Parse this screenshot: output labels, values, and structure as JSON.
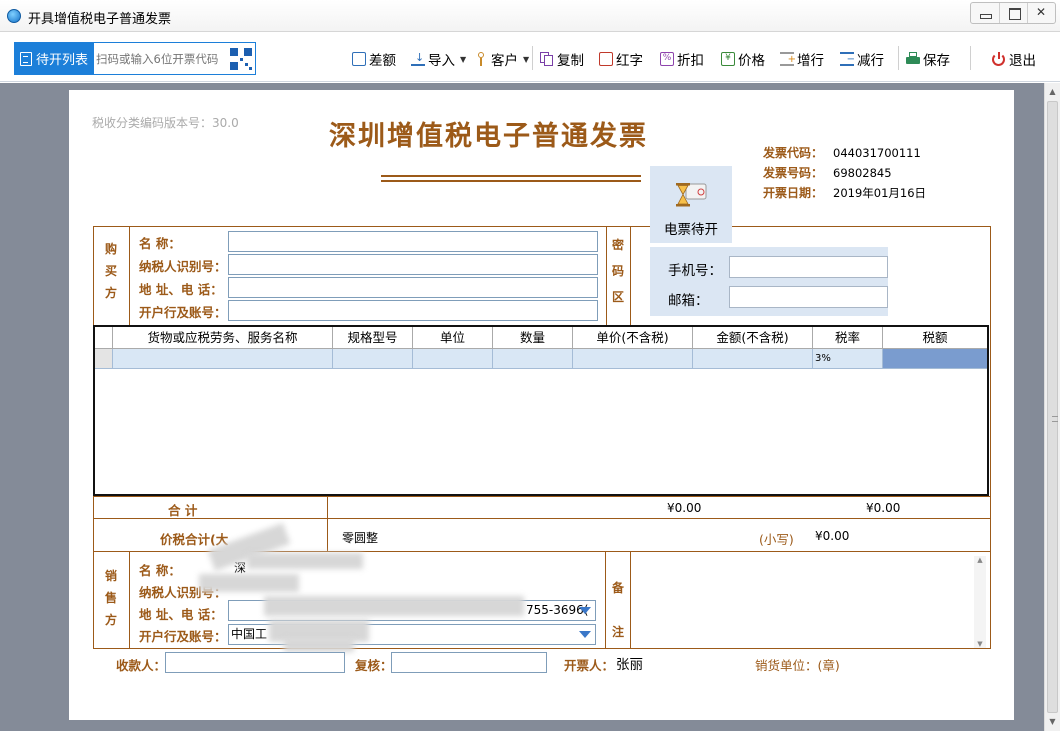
{
  "window": {
    "title": "开具增值税电子普通发票"
  },
  "toolbar": {
    "pending_list": "待开列表",
    "scan_placeholder": "扫码或输入6位开票代码",
    "items": {
      "diff": "差额",
      "import": "导入",
      "customer": "客户",
      "copy": "复制",
      "red": "红字",
      "discount": "折扣",
      "price": "价格",
      "add_row": "增行",
      "del_row": "减行",
      "save": "保存",
      "exit": "退出"
    }
  },
  "invoice": {
    "category_version": "税收分类编码版本号：30.0",
    "title": "深圳增值税电子普通发票",
    "code_label": "发票代码：",
    "code": "044031700111",
    "number_label": "发票号码：",
    "number": "69802845",
    "date_label": "开票日期：",
    "date": "2019年01月16日",
    "e_invoice_pending": "电票待开",
    "phone_label": "手机号：",
    "email_label": "邮箱：",
    "buyer": {
      "side_label": [
        "购",
        "买",
        "方"
      ],
      "name_label": "名        称：",
      "taxid_label": "纳税人识别号：",
      "address_label": "地 址、电 话：",
      "bank_label": "开户行及账号："
    },
    "cipher_label": [
      "密",
      "码",
      "区"
    ],
    "columns": [
      "货物或应税劳务、服务名称",
      "规格型号",
      "单位",
      "数量",
      "单价(不含税)",
      "金额(不含税)",
      "税率",
      "税额"
    ],
    "row1": {
      "tax_rate": "3%"
    },
    "total_label": "合        计",
    "total_amount": "¥0.00",
    "total_tax": "¥0.00",
    "price_tax_total_label": "价税合计(大",
    "amount_in_words": "零圆整",
    "lowercase_label": "(小写)",
    "amount_lowercase": "¥0.00",
    "seller": {
      "side_label": [
        "销",
        "售",
        "方"
      ],
      "name_label": "名        称：",
      "name_partial": "深",
      "taxid_label": "纳税人识别号：",
      "address_label": "地 址、电 话：",
      "address_partial": "755-3696(",
      "bank_label": "开户行及账号：",
      "bank_partial": "中国工"
    },
    "remarks_label": [
      "备",
      "注"
    ],
    "payee_label": "收款人：",
    "reviewer_label": "复核：",
    "drawer_label": "开票人：",
    "drawer": "张丽",
    "seller_seal": "销货单位：(章)"
  },
  "colors": {
    "accent": "#1c7fd9",
    "invoice_brown": "#9c5a19",
    "workspace": "#848b98"
  }
}
